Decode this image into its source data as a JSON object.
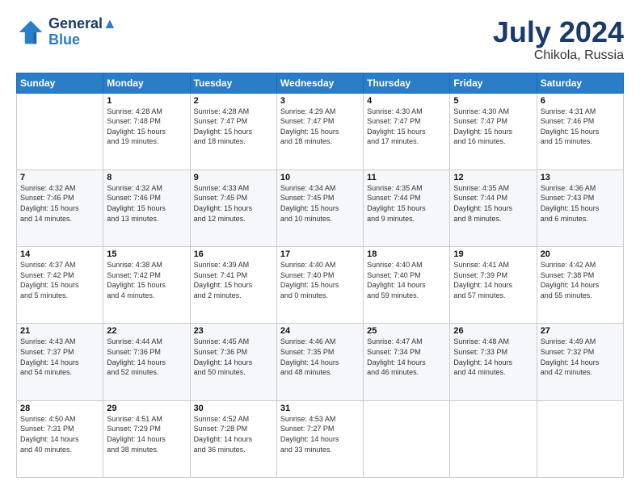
{
  "header": {
    "logo_line1": "General",
    "logo_line2": "Blue",
    "title": "July 2024",
    "subtitle": "Chikola, Russia"
  },
  "weekdays": [
    "Sunday",
    "Monday",
    "Tuesday",
    "Wednesday",
    "Thursday",
    "Friday",
    "Saturday"
  ],
  "weeks": [
    [
      {
        "day": "",
        "info": ""
      },
      {
        "day": "1",
        "info": "Sunrise: 4:28 AM\nSunset: 7:48 PM\nDaylight: 15 hours\nand 19 minutes."
      },
      {
        "day": "2",
        "info": "Sunrise: 4:28 AM\nSunset: 7:47 PM\nDaylight: 15 hours\nand 18 minutes."
      },
      {
        "day": "3",
        "info": "Sunrise: 4:29 AM\nSunset: 7:47 PM\nDaylight: 15 hours\nand 18 minutes."
      },
      {
        "day": "4",
        "info": "Sunrise: 4:30 AM\nSunset: 7:47 PM\nDaylight: 15 hours\nand 17 minutes."
      },
      {
        "day": "5",
        "info": "Sunrise: 4:30 AM\nSunset: 7:47 PM\nDaylight: 15 hours\nand 16 minutes."
      },
      {
        "day": "6",
        "info": "Sunrise: 4:31 AM\nSunset: 7:46 PM\nDaylight: 15 hours\nand 15 minutes."
      }
    ],
    [
      {
        "day": "7",
        "info": "Sunrise: 4:32 AM\nSunset: 7:46 PM\nDaylight: 15 hours\nand 14 minutes."
      },
      {
        "day": "8",
        "info": "Sunrise: 4:32 AM\nSunset: 7:46 PM\nDaylight: 15 hours\nand 13 minutes."
      },
      {
        "day": "9",
        "info": "Sunrise: 4:33 AM\nSunset: 7:45 PM\nDaylight: 15 hours\nand 12 minutes."
      },
      {
        "day": "10",
        "info": "Sunrise: 4:34 AM\nSunset: 7:45 PM\nDaylight: 15 hours\nand 10 minutes."
      },
      {
        "day": "11",
        "info": "Sunrise: 4:35 AM\nSunset: 7:44 PM\nDaylight: 15 hours\nand 9 minutes."
      },
      {
        "day": "12",
        "info": "Sunrise: 4:35 AM\nSunset: 7:44 PM\nDaylight: 15 hours\nand 8 minutes."
      },
      {
        "day": "13",
        "info": "Sunrise: 4:36 AM\nSunset: 7:43 PM\nDaylight: 15 hours\nand 6 minutes."
      }
    ],
    [
      {
        "day": "14",
        "info": "Sunrise: 4:37 AM\nSunset: 7:42 PM\nDaylight: 15 hours\nand 5 minutes."
      },
      {
        "day": "15",
        "info": "Sunrise: 4:38 AM\nSunset: 7:42 PM\nDaylight: 15 hours\nand 4 minutes."
      },
      {
        "day": "16",
        "info": "Sunrise: 4:39 AM\nSunset: 7:41 PM\nDaylight: 15 hours\nand 2 minutes."
      },
      {
        "day": "17",
        "info": "Sunrise: 4:40 AM\nSunset: 7:40 PM\nDaylight: 15 hours\nand 0 minutes."
      },
      {
        "day": "18",
        "info": "Sunrise: 4:40 AM\nSunset: 7:40 PM\nDaylight: 14 hours\nand 59 minutes."
      },
      {
        "day": "19",
        "info": "Sunrise: 4:41 AM\nSunset: 7:39 PM\nDaylight: 14 hours\nand 57 minutes."
      },
      {
        "day": "20",
        "info": "Sunrise: 4:42 AM\nSunset: 7:38 PM\nDaylight: 14 hours\nand 55 minutes."
      }
    ],
    [
      {
        "day": "21",
        "info": "Sunrise: 4:43 AM\nSunset: 7:37 PM\nDaylight: 14 hours\nand 54 minutes."
      },
      {
        "day": "22",
        "info": "Sunrise: 4:44 AM\nSunset: 7:36 PM\nDaylight: 14 hours\nand 52 minutes."
      },
      {
        "day": "23",
        "info": "Sunrise: 4:45 AM\nSunset: 7:36 PM\nDaylight: 14 hours\nand 50 minutes."
      },
      {
        "day": "24",
        "info": "Sunrise: 4:46 AM\nSunset: 7:35 PM\nDaylight: 14 hours\nand 48 minutes."
      },
      {
        "day": "25",
        "info": "Sunrise: 4:47 AM\nSunset: 7:34 PM\nDaylight: 14 hours\nand 46 minutes."
      },
      {
        "day": "26",
        "info": "Sunrise: 4:48 AM\nSunset: 7:33 PM\nDaylight: 14 hours\nand 44 minutes."
      },
      {
        "day": "27",
        "info": "Sunrise: 4:49 AM\nSunset: 7:32 PM\nDaylight: 14 hours\nand 42 minutes."
      }
    ],
    [
      {
        "day": "28",
        "info": "Sunrise: 4:50 AM\nSunset: 7:31 PM\nDaylight: 14 hours\nand 40 minutes."
      },
      {
        "day": "29",
        "info": "Sunrise: 4:51 AM\nSunset: 7:29 PM\nDaylight: 14 hours\nand 38 minutes."
      },
      {
        "day": "30",
        "info": "Sunrise: 4:52 AM\nSunset: 7:28 PM\nDaylight: 14 hours\nand 36 minutes."
      },
      {
        "day": "31",
        "info": "Sunrise: 4:53 AM\nSunset: 7:27 PM\nDaylight: 14 hours\nand 33 minutes."
      },
      {
        "day": "",
        "info": ""
      },
      {
        "day": "",
        "info": ""
      },
      {
        "day": "",
        "info": ""
      }
    ]
  ]
}
